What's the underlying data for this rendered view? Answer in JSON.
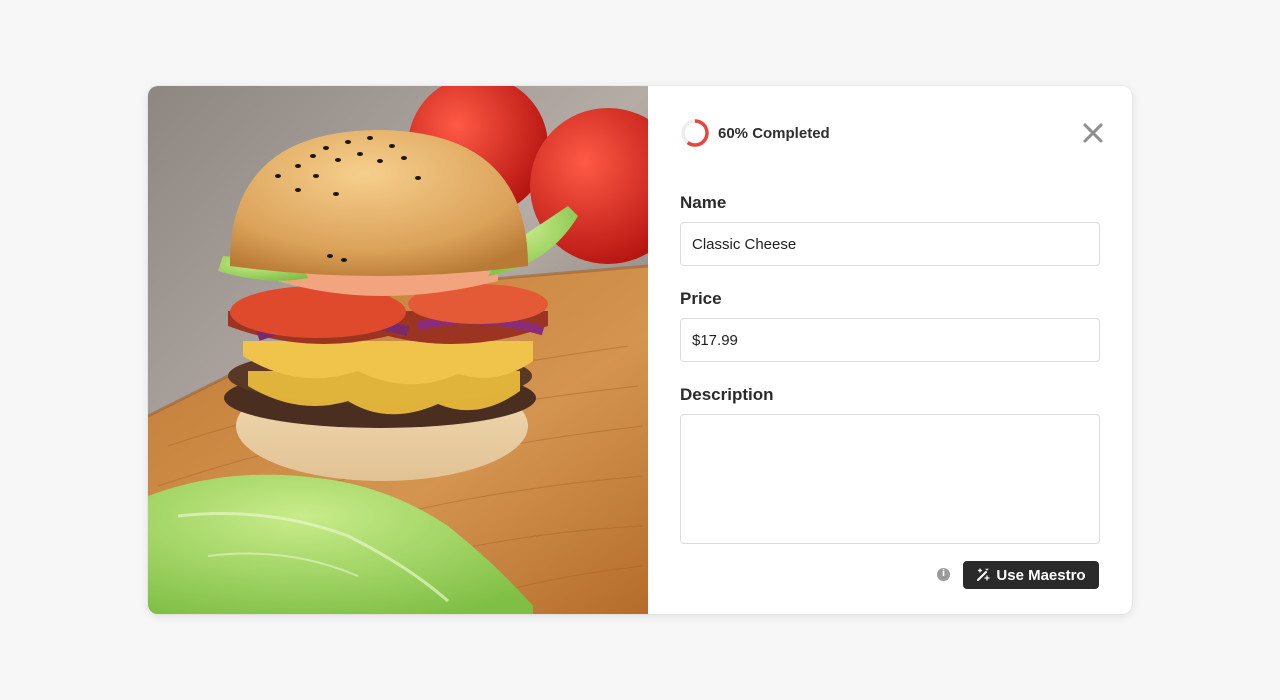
{
  "progress": {
    "percent": 60,
    "label": "60% Completed",
    "accent_color": "#e8453c",
    "track_color": "#eeeeee"
  },
  "close_icon": "close-icon",
  "photo": {
    "icon": "burger-photo"
  },
  "form": {
    "name": {
      "label": "Name",
      "value": "Classic Cheese"
    },
    "price": {
      "label": "Price",
      "value": "$17.99"
    },
    "description": {
      "label": "Description",
      "value": ""
    },
    "info_icon": "info-icon",
    "maestro_button": {
      "label": "Use Maestro",
      "icon": "magic-wand-icon",
      "bg_color": "#2a2a2a"
    }
  }
}
